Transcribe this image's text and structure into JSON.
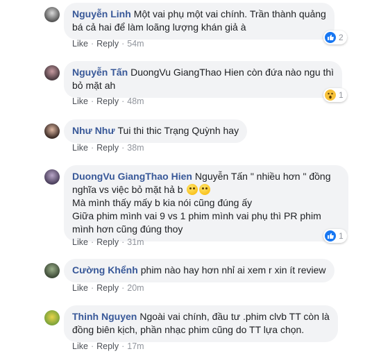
{
  "comments": [
    {
      "author": "Nguyễn Linh",
      "lines": [
        "Một vai phụ một vai chính. Trần thành quảng",
        "bá cả hai để làm loãng lượng khán giả à"
      ],
      "actions": {
        "like": "Like",
        "reply": "Reply",
        "time": "54m"
      },
      "reaction": {
        "icon": "like-reaction-icon",
        "count": "2"
      }
    },
    {
      "author": "Nguyễn Tấn",
      "lines": [
        "DuongVu GiangThao Hien còn đứa nào ngu thì",
        "bỏ mặt ah"
      ],
      "actions": {
        "like": "Like",
        "reply": "Reply",
        "time": "48m"
      },
      "reaction": {
        "icon": "wow-reaction-icon",
        "count": "1"
      }
    },
    {
      "author": "Như Như",
      "lines": [
        "Tui thi thic Trạng Quỳnh hay"
      ],
      "actions": {
        "like": "Like",
        "reply": "Reply",
        "time": "38m"
      }
    },
    {
      "author": "DuongVu GiangThao Hien",
      "lines": [
        "Nguyễn Tấn \" nhiều hơn \" đồng",
        "nghĩa vs việc bỏ mặt hả b",
        "Mà mình thấy mấy b kia nói cũng đúng ấy",
        "Giữa phim mình vai 9 vs 1 phim mình vai phụ thì PR phim",
        "mình hơn cũng đúng thoy"
      ],
      "actions": {
        "like": "Like",
        "reply": "Reply",
        "time": "31m"
      },
      "reaction": {
        "icon": "like-reaction-icon",
        "count": "1"
      }
    },
    {
      "author": "Cường Khểnh",
      "lines": [
        "phim nào hay hơn nhỉ ai xem r xin ít review"
      ],
      "actions": {
        "like": "Like",
        "reply": "Reply",
        "time": "20m"
      }
    },
    {
      "author": "Thinh Nguyen",
      "lines": [
        "Ngoài vai chính, đầu tư .phim clvb TT còn là",
        "đồng biên kịch, phần nhạc phim cũng do TT lựa chọn."
      ],
      "actions": {
        "like": "Like",
        "reply": "Reply",
        "time": "17m"
      }
    }
  ],
  "colors": {
    "author": "#385898",
    "bubble": "#f2f3f5",
    "meta": "#90949c",
    "like_blue": "#1877f2"
  }
}
